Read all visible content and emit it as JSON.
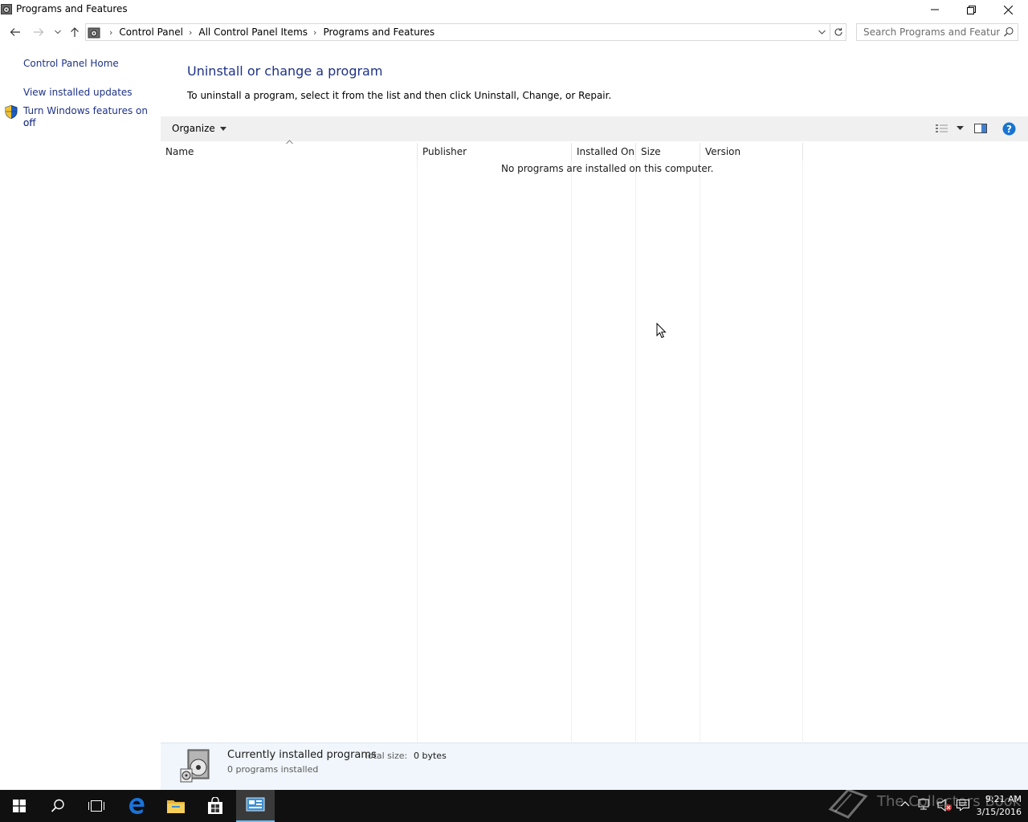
{
  "window": {
    "title": "Programs and Features",
    "controls": {
      "minimize": "minimize-icon",
      "restore": "restore-icon",
      "close": "close-icon"
    }
  },
  "address_bar": {
    "breadcrumbs": [
      "Control Panel",
      "All Control Panel Items",
      "Programs and Features"
    ],
    "search_placeholder": "Search Programs and Features"
  },
  "left_pane": {
    "home_link": "Control Panel Home",
    "updates_link": "View installed updates",
    "features_link_line1": "Turn Windows features on or",
    "features_link_line2": "off"
  },
  "main": {
    "heading": "Uninstall or change a program",
    "description": "To uninstall a program, select it from the list and then click Uninstall, Change, or Repair."
  },
  "toolbar": {
    "organize_label": "Organize"
  },
  "list": {
    "columns": [
      "Name",
      "Publisher",
      "Installed On",
      "Size",
      "Version"
    ],
    "empty_message": "No programs are installed on this computer."
  },
  "details": {
    "title": "Currently installed programs",
    "total_size_label": "Total size:",
    "total_size_value": "0 bytes",
    "count_text": "0 programs installed"
  },
  "taskbar": {
    "watermark": "The Collectors Book",
    "time": "9:21 AM",
    "date": "3/15/2016"
  },
  "colors": {
    "link": "#1e3287",
    "toolbar_bg": "#f0f0f0",
    "details_bg": "#f0f6fb",
    "taskbar_bg": "#101010",
    "accent": "#76b9ed"
  }
}
